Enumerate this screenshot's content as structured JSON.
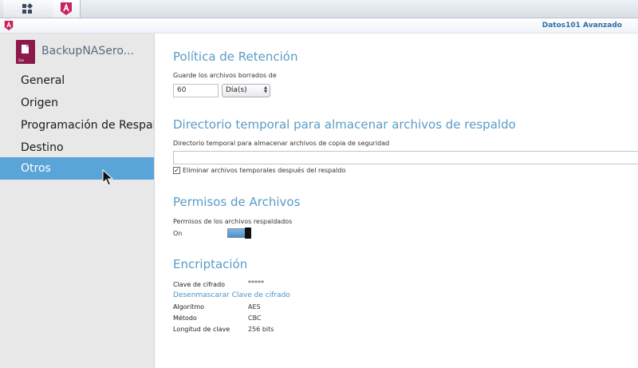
{
  "taskbar": {
    "apps_icon": "grid-icon",
    "app_icon": "backup-app-icon"
  },
  "header": {
    "user": "Datos101 Avanzado"
  },
  "sidebar": {
    "title": "BackupNASero...",
    "file_ext": "Sav",
    "items": [
      {
        "label": "General"
      },
      {
        "label": "Origen"
      },
      {
        "label": "Programación de Respaldo"
      },
      {
        "label": "Destino"
      },
      {
        "label": "Otros"
      }
    ],
    "active_index": 4
  },
  "retention": {
    "heading": "Política de Retención",
    "label": "Guarde los archivos borrados de",
    "value": "60",
    "unit": "Día(s)"
  },
  "tempdir": {
    "heading": "Directorio temporal para almacenar archivos de respaldo",
    "label": "Directorio temporal para almacenar archivos de copia de seguridad",
    "value": "",
    "checkbox_label": "Eliminar archivos temporales después del respaldo",
    "checkbox_checked": true
  },
  "permissions": {
    "heading": "Permisos de Archivos",
    "label": "Permisos de los archivos respaldados",
    "state": "On"
  },
  "encryption": {
    "heading": "Encriptación",
    "key_label": "Clave de cifrado",
    "key_value": "*****",
    "unmask_link": "Desenmascarar Clave de cifrado",
    "algorithm_label": "Algoritmo",
    "algorithm_value": "AES",
    "method_label": "Método",
    "method_value": "CBC",
    "keylen_label": "Longitud de clave",
    "keylen_value": "256 bits"
  },
  "colors": {
    "accent": "#5aa5d8",
    "heading": "#5b9bc8",
    "brand": "#8b1a4a"
  }
}
